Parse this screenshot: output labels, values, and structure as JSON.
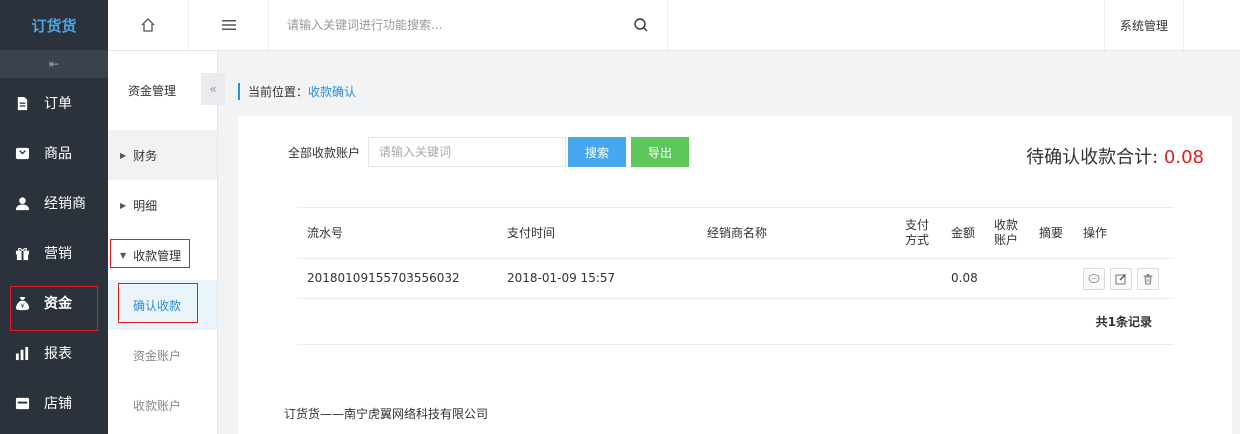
{
  "brand": {
    "logo": "订货货"
  },
  "sidebar": {
    "items": [
      {
        "label": "订单",
        "icon": "document-icon"
      },
      {
        "label": "商品",
        "icon": "box-icon"
      },
      {
        "label": "经销商",
        "icon": "user-icon"
      },
      {
        "label": "营销",
        "icon": "gift-icon"
      },
      {
        "label": "资金",
        "icon": "money-bag-icon"
      },
      {
        "label": "报表",
        "icon": "bar-chart-icon"
      },
      {
        "label": "店铺",
        "icon": "store-icon"
      }
    ],
    "active_index": 4
  },
  "topbar": {
    "search_placeholder": "请输入关键词进行功能搜索...",
    "system_label": "系统管理"
  },
  "subnav": {
    "title": "资金管理",
    "groups": [
      {
        "label": "财务"
      },
      {
        "label": "明细"
      },
      {
        "label": "收款管理"
      }
    ],
    "items": [
      {
        "label": "确认收款"
      },
      {
        "label": "资金账户"
      },
      {
        "label": "收款账户"
      }
    ]
  },
  "breadcrumb": {
    "prefix": "当前位置：",
    "current": "收款确认"
  },
  "filter": {
    "label": "全部收款账户",
    "placeholder": "请输入关键词",
    "search_button": "搜索",
    "export_button": "导出"
  },
  "summary": {
    "label": "待确认收款合计: ",
    "amount": "0.08"
  },
  "table": {
    "headers": {
      "flow": "流水号",
      "time": "支付时间",
      "dealer": "经销商名称",
      "pay_method": "支付方式",
      "amount": "金额",
      "account": "收款账户",
      "memo": "摘要",
      "ops": "操作"
    },
    "rows": [
      {
        "flow": "20180109155703556032",
        "time": "2018-01-09 15:57",
        "dealer": "",
        "pay_method": "",
        "amount": "0.08",
        "account": "",
        "memo": ""
      }
    ],
    "total_text": "共1条记录"
  },
  "footer": {
    "text": "订货货——南宁虎翼网络科技有限公司"
  },
  "colors": {
    "accent": "#2d8ed8",
    "sidebar_bg": "#2b323b",
    "total_red": "#e02020",
    "search_btn": "#48a8ef",
    "export_btn": "#5cc85c"
  }
}
